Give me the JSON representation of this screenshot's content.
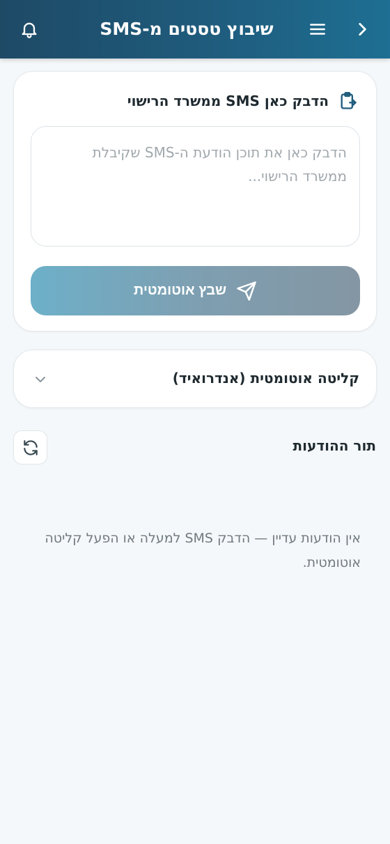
{
  "header": {
    "title": "שיבוץ טסטים מ-SMS",
    "back_icon": "chevron-right-icon",
    "menu_icon": "hamburger-menu-icon",
    "bell_icon": "bell-icon"
  },
  "paste_card": {
    "title": "הדבק כאן SMS ממשרד הרישוי",
    "icon": "clipboard-icon",
    "textarea_value": "",
    "textarea_placeholder": "הדבק כאן את תוכן הודעת ה-SMS שקיבלת ממשרד הרישוי...",
    "submit_label": "שבץ אוטומטית",
    "submit_icon": "send-icon"
  },
  "auto_card": {
    "label": "קליטה אוטומטית (אנדרואיד)",
    "icon": "chevron-down-icon"
  },
  "queue": {
    "title": "תור ההודעות",
    "refresh_icon": "refresh-icon",
    "empty_text": "אין הודעות עדיין — הדבק SMS למעלה או הפעל קליטה אוטומטית."
  },
  "colors": {
    "header_start": "#1e4a66",
    "header_end": "#1e6f93",
    "button_start": "#6db0c9",
    "button_end": "#8496a3",
    "background": "#f5f8fa"
  }
}
